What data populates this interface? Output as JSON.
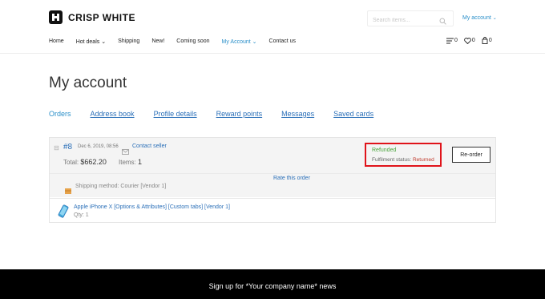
{
  "brand": {
    "name": "CRISP WHITE"
  },
  "header": {
    "search_placeholder": "Search items...",
    "account_label": "My account",
    "account_chevron": "⌄",
    "compare_count": "0",
    "wishlist_count": "0",
    "cart_count": "0"
  },
  "nav": {
    "items": [
      {
        "label": "Home"
      },
      {
        "label": "Hot deals ⌄"
      },
      {
        "label": "Shipping"
      },
      {
        "label": "New!"
      },
      {
        "label": "Coming soon"
      },
      {
        "label": "My Account ⌄"
      },
      {
        "label": "Contact us"
      }
    ]
  },
  "page": {
    "title": "My account",
    "tabs": [
      {
        "label": "Orders"
      },
      {
        "label": "Address book"
      },
      {
        "label": "Profile details"
      },
      {
        "label": "Reward points"
      },
      {
        "label": "Messages"
      },
      {
        "label": "Saved cards"
      }
    ]
  },
  "order": {
    "collapse_symbol": "⊟",
    "number": "#8",
    "date": "Dec 6, 2019, 08:56",
    "contact_label": "Contact seller",
    "total_label": "Total:",
    "total_value": "$662.20",
    "items_label": "Items:",
    "items_value": "1",
    "status": "Refunded",
    "fulfilment_label": "Fulfilment status:",
    "fulfilment_value": "Returned",
    "reorder_label": "Re-order",
    "rate_label": "Rate this order",
    "shipping_text": "Shipping method: Courier [Vendor 1]",
    "product_name": "Apple iPhone X [Options & Attributes] [Custom tabs] [Vendor 1]",
    "product_qty": "Qty: 1"
  },
  "footer": {
    "signup_text": "Sign up for *Your company name* news"
  },
  "colors": {
    "accent": "#2a8fc9",
    "link": "#2a6fb8",
    "success": "#4aa53d",
    "danger": "#e0131a",
    "footer_bg": "#000000"
  }
}
